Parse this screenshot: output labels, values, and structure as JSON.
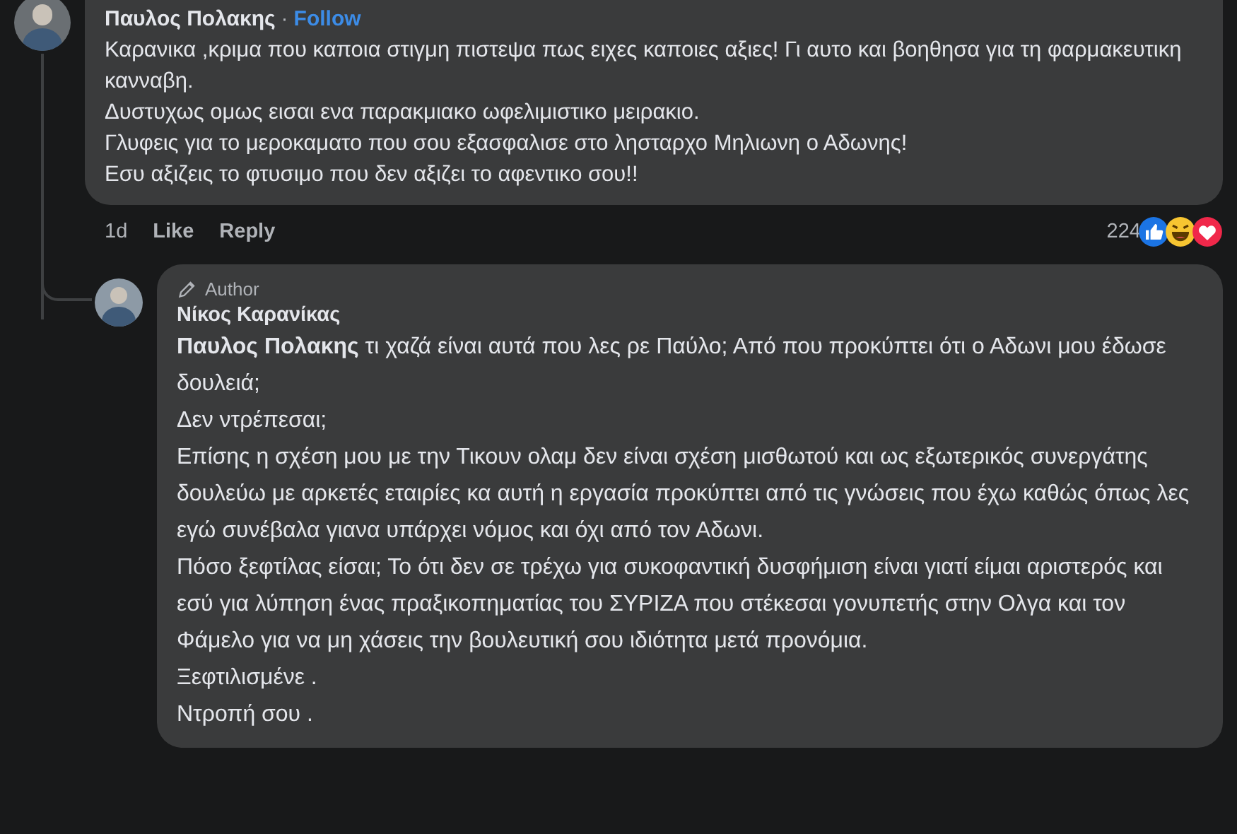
{
  "comments": [
    {
      "author": "Παυλος Πολακης",
      "separator": "·",
      "follow": "Follow",
      "paragraphs": [
        "Καρανικα ,κριμα που καποια στιγμη πιστεψα πως ειχες καποιες αξιες! Γι αυτο και βοηθησα για τη φαρμακευτικη κανναβη.",
        "Δυστυχως ομως εισαι ενα παρακμιακο ωφελιμιστικο μειρακιο.",
        "Γλυφεις για το μεροκαματο που σου εξασφαλισε στο λησταρχο Μηλιωνη ο Αδωνης!",
        "Εσυ αξιζεις το φτυσιμο που δεν αξιζει το αφεντικο σου!!"
      ],
      "time": "1d",
      "actions": [
        "Like",
        "Reply"
      ],
      "reaction_count": "224",
      "reactions": [
        {
          "kind": "like"
        },
        {
          "kind": "haha"
        },
        {
          "kind": "love"
        }
      ]
    },
    {
      "badge": "Author",
      "author": "Νίκος Καρανίκας",
      "paragraphs": [
        "**Παυλος Πολακης** τι χαζά είναι αυτά που λες ρε Παύλο; Από που προκύπτει ότι ο Αδωνι μου έδωσε δουλειά;",
        "Δεν ντρέπεσαι;",
        "Επίσης η σχέση μου με την Τικουν ολαμ δεν είναι σχέση μισθωτού και ως εξωτερικός συνεργάτης δουλεύω με αρκετές εταιρίες κα αυτή η εργασία προκύπτει από τις γνώσεις που έχω καθώς όπως λες εγώ συνέβαλα γιανα υπάρχει νόμος και όχι από τον Αδωνι.",
        "Πόσο ξεφτίλας είσαι; Το ότι δεν σε τρέχω για συκοφαντική δυσφήμιση είναι γιατί είμαι αριστερός και εσύ για λύπηση ένας πραξικοπηματίας του ΣΥΡΙΖΑ που στέκεσαι γονυπετής στην Ολγα και τον Φάμελο για να μη χάσεις την βουλευτική σου ιδιότητα μετά προνόμια.",
        "Ξεφτιλισμένε .",
        "Ντροπή σου ."
      ]
    }
  ]
}
